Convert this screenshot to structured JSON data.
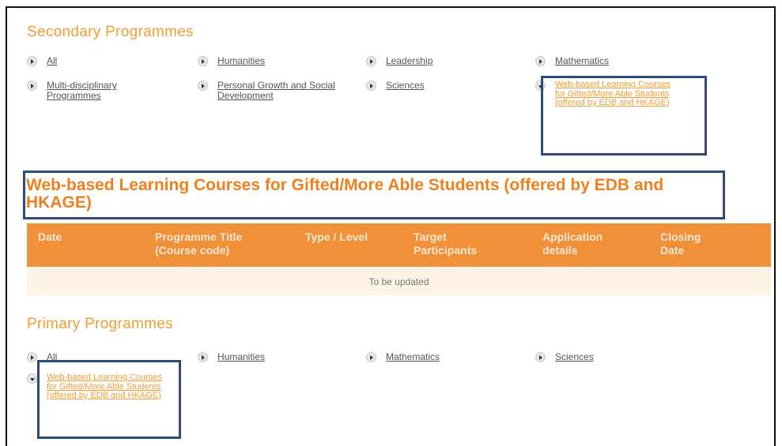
{
  "secondary": {
    "heading": "Secondary Programmes",
    "links": {
      "all": "All",
      "humanities": "Humanities",
      "leadership": "Leadership",
      "mathematics": "Mathematics",
      "multi": "Multi-disciplinary Programmes",
      "personal": "Personal Growth and Social Development",
      "sciences": "Sciences",
      "webbased": "Web-based Learning Courses for Gifted/More Able Students (offered by EDB and HKAGE)"
    }
  },
  "section": {
    "title": "Web-based Learning Courses for Gifted/More Able Students (offered by EDB and HKAGE)"
  },
  "table": {
    "headers": {
      "date": "Date",
      "title": "Programme Title (Course code)",
      "type": "Type / Level",
      "target": "Target Participants",
      "application": "Application details",
      "closing": "Closing Date"
    },
    "empty_message": "To be updated"
  },
  "primary": {
    "heading": "Primary Programmes",
    "links": {
      "all": "All",
      "humanities": "Humanities",
      "mathematics": "Mathematics",
      "sciences": "Sciences",
      "webbased": "Web-based Learning Courses for Gifted/More Able Students (offered by EDB and HKAGE)"
    }
  },
  "colors": {
    "accent": "#f39c34",
    "table_header": "#f0913a",
    "table_row": "#fdf3e4",
    "highlight_box": "#2f4b78"
  }
}
